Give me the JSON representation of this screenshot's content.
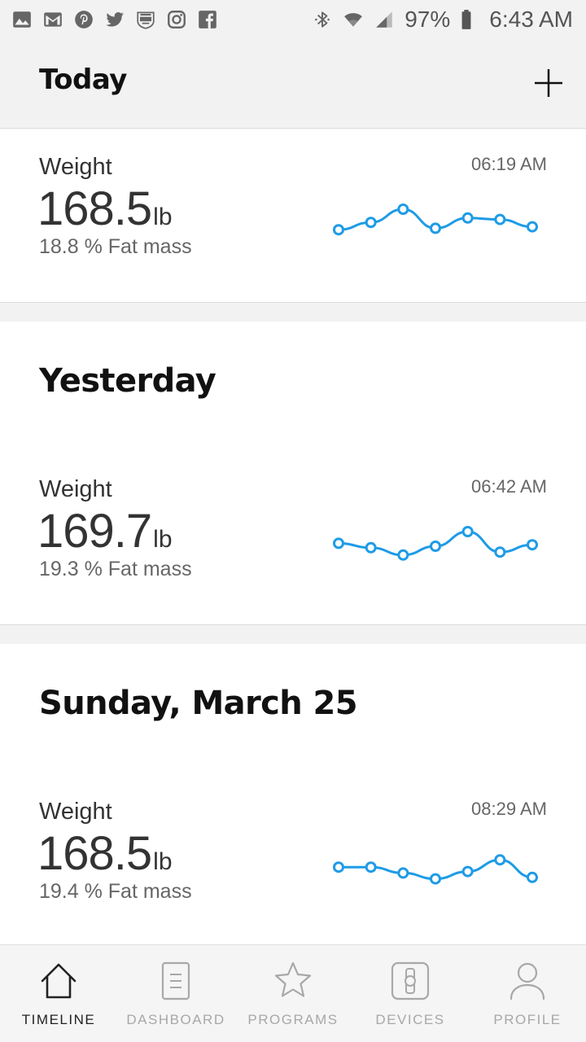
{
  "status_bar": {
    "left_icons": [
      "gallery-icon",
      "gmail-icon",
      "pinterest-icon",
      "twitter-icon",
      "crossfit-games-icon",
      "instagram-icon",
      "facebook-icon"
    ],
    "battery": "97%",
    "time": "6:43 AM"
  },
  "header": {
    "title": "Today",
    "add_icon": "plus-icon"
  },
  "sections": [
    {
      "title": "",
      "entry": {
        "label": "Weight",
        "value": "168.5",
        "unit": "lb",
        "sub": "18.8 % Fat mass",
        "time": "06:19 AM",
        "trend": [
          0.3,
          0.55,
          1.0,
          0.35,
          0.7,
          0.65,
          0.4
        ]
      }
    },
    {
      "title": "Yesterday",
      "entry": {
        "label": "Weight",
        "value": "169.7",
        "unit": "lb",
        "sub": "19.3 % Fat mass",
        "time": "06:42 AM",
        "trend": [
          0.6,
          0.45,
          0.2,
          0.5,
          1.0,
          0.3,
          0.55
        ]
      }
    },
    {
      "title": "Sunday, March 25",
      "entry": {
        "label": "Weight",
        "value": "168.5",
        "unit": "lb",
        "sub": "19.4 % Fat mass",
        "time": "08:29 AM",
        "trend": [
          0.55,
          0.55,
          0.35,
          0.15,
          0.4,
          0.8,
          0.2
        ]
      }
    }
  ],
  "colors": {
    "accent": "#1e9be6",
    "nav_active": "#222222",
    "nav_inactive": "#a8a8a8"
  },
  "bottom_nav": [
    {
      "label": "TIMELINE",
      "icon": "home-icon",
      "active": true
    },
    {
      "label": "DASHBOARD",
      "icon": "document-icon",
      "active": false
    },
    {
      "label": "PROGRAMS",
      "icon": "star-icon",
      "active": false
    },
    {
      "label": "DEVICES",
      "icon": "watch-icon",
      "active": false
    },
    {
      "label": "PROFILE",
      "icon": "person-icon",
      "active": false
    }
  ]
}
